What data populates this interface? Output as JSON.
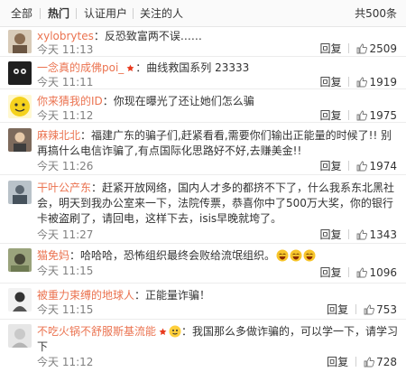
{
  "tabs": [
    {
      "label": "全部"
    },
    {
      "label": "热门"
    },
    {
      "label": "认证用户"
    },
    {
      "label": "关注的人"
    }
  ],
  "total_label": "共500条",
  "accent_color": "#eb7350",
  "reply_label": "回复",
  "comments": [
    {
      "username": "xylobrytes",
      "text": "：反恐致富两不误……",
      "time": "今天 11:13",
      "likes": "2509"
    },
    {
      "username": "一念真的成佛poi_",
      "text": "：曲线救国系列 23333",
      "time": "今天 11:11",
      "likes": "1919"
    },
    {
      "username": "你来猜我的ID",
      "text": "：你现在曝光了还让她们怎么骗",
      "time": "今天 11:12",
      "likes": "1975"
    },
    {
      "username": "麻辣北北",
      "text": "：福建广东的骗子们,赶紧看看,需要你们输出正能量的时候了!! 别再搞什么电信诈骗了,有点国际化思路好不好,去赚美金!!",
      "time": "今天 11:26",
      "likes": "1974"
    },
    {
      "username": "干叶公产东",
      "text": "：赶紧开放网络，国内人才多的都挤不下了，什么我系东北黑社会，明天到我办公室来一下，法院传票，恭喜你中了500万大奖，你的银行卡被盗刷了，请回电，这样下去，isis早晚就垮了。",
      "time": "今天 11:27",
      "likes": "1343"
    },
    {
      "username": "猫免妈",
      "text": "：哈哈哈，恐怖组织最终会败给流氓组织。",
      "time": "今天 11:15",
      "likes": "1096"
    },
    {
      "username": "被重力束缚的地球人",
      "text": "：正能量诈骗！",
      "time": "今天 11:15",
      "likes": "753"
    },
    {
      "username": "不吃火锅不舒服斯基流能",
      "text": "：我国那么多做诈骗的，可以学一下，请学习下",
      "time": "今天 11:12",
      "likes": "728"
    }
  ]
}
